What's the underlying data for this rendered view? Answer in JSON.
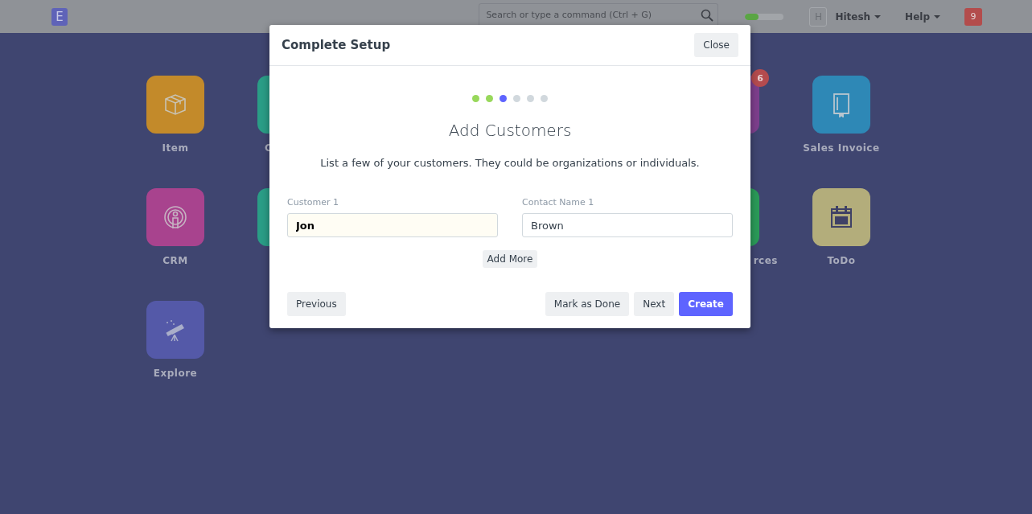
{
  "navbar": {
    "logo": "E",
    "search": {
      "placeholder": "Search or type a command (Ctrl + G)"
    },
    "setup_progress": {
      "level": 0.35
    },
    "avatar": "H",
    "user": "Hitesh",
    "help": "Help",
    "notifications": "9"
  },
  "desktop": {
    "tiles": [
      {
        "label": "Item",
        "color": "#c38a2a",
        "kind": "box"
      },
      {
        "label": "C",
        "color": "#2a9d86",
        "kind": "plain"
      },
      {
        "color": "#7d3f8c",
        "kind": "plain",
        "badge": "6"
      },
      {
        "label": "Sales Invoice",
        "color": "#2e88b6",
        "kind": "book"
      },
      {
        "label": "CRM",
        "color": "#a8438e",
        "kind": "crm"
      },
      {
        "color": "#2a9d86",
        "kind": "plain"
      },
      {
        "label": "rces",
        "color": "#2a9a58",
        "kind": "plain"
      },
      {
        "label": "ToDo",
        "color": "#b3ad7b",
        "kind": "calendar"
      },
      {
        "label": "Explore",
        "color": "#5459a8",
        "kind": "telescope"
      }
    ]
  },
  "modal": {
    "title": "Complete Setup",
    "close": "Close",
    "steps": [
      {
        "done": true,
        "selected": false
      },
      {
        "done": true,
        "selected": false
      },
      {
        "done": false,
        "selected": true
      },
      {
        "done": false,
        "selected": false
      },
      {
        "done": false,
        "selected": false
      },
      {
        "done": false,
        "selected": false
      }
    ],
    "heading": "Add Customers",
    "text": "List a few of your customers. They could be organizations or individuals.",
    "fields": [
      {
        "label": "Customer 1",
        "value": "Jon",
        "focused": true
      },
      {
        "label": "Contact Name 1",
        "value": "Brown",
        "focused": false
      }
    ],
    "add_more": "Add More",
    "previous": "Previous",
    "mark_done": "Mark as Done",
    "next": "Next",
    "create": "Create"
  }
}
